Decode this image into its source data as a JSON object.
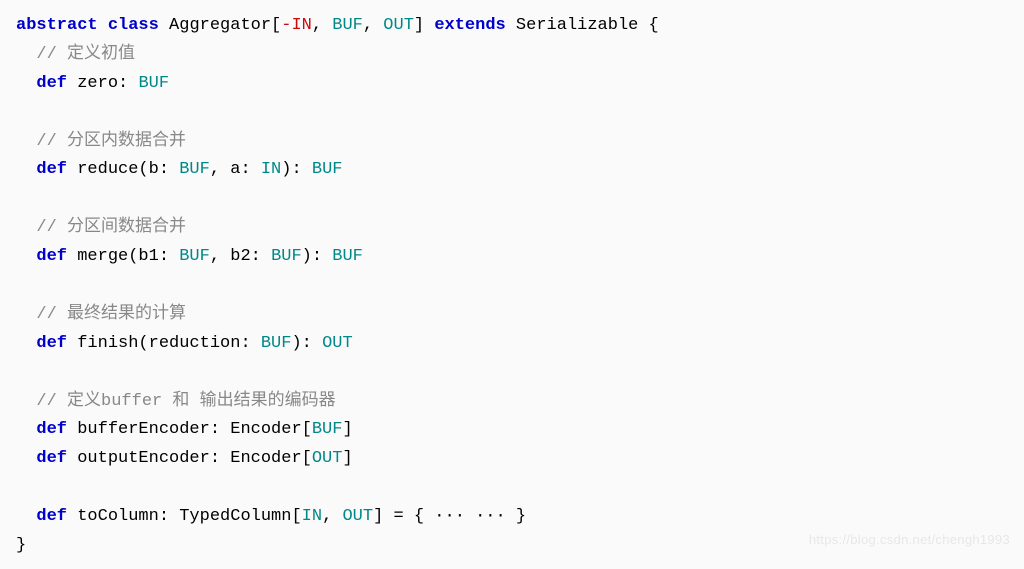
{
  "code": {
    "line1": {
      "abstract": "abstract",
      "class": "class",
      "classname": " Aggregator[",
      "neg": "-IN",
      "sep1": ", ",
      "buf": "BUF",
      "sep2": ", ",
      "out": "OUT",
      "close": "] ",
      "extends": "extends",
      "rest": " Serializable {"
    },
    "comment1": "  // 定义初值",
    "line2": {
      "indent": "  ",
      "def": "def",
      "name": " zero: ",
      "type": "BUF"
    },
    "comment2": "  // 分区内数据合并",
    "line3": {
      "indent": "  ",
      "def": "def",
      "name": " reduce(b: ",
      "buf1": "BUF",
      "sep": ", a: ",
      "in": "IN",
      "close": "): ",
      "ret": "BUF"
    },
    "comment3": "  // 分区间数据合并",
    "line4": {
      "indent": "  ",
      "def": "def",
      "name": " merge(b1: ",
      "buf1": "BUF",
      "sep": ", b2: ",
      "buf2": "BUF",
      "close": "): ",
      "ret": "BUF"
    },
    "comment4": "  // 最终结果的计算",
    "line5": {
      "indent": "  ",
      "def": "def",
      "name": " finish(reduction: ",
      "buf": "BUF",
      "close": "): ",
      "ret": "OUT"
    },
    "comment5": "  // 定义buffer 和 输出结果的编码器",
    "line6": {
      "indent": "  ",
      "def": "def",
      "name": " bufferEncoder: Encoder[",
      "type": "BUF",
      "close": "]"
    },
    "line7": {
      "indent": "  ",
      "def": "def",
      "name": " outputEncoder: Encoder[",
      "type": "OUT",
      "close": "]"
    },
    "line8": {
      "indent": "  ",
      "def": "def",
      "name": " toColumn: TypedColumn[",
      "in": "IN",
      "sep": ", ",
      "out": "OUT",
      "close": "] = { ··· ··· }"
    },
    "closing": "}"
  },
  "watermark": "https://blog.csdn.net/chengh1993"
}
